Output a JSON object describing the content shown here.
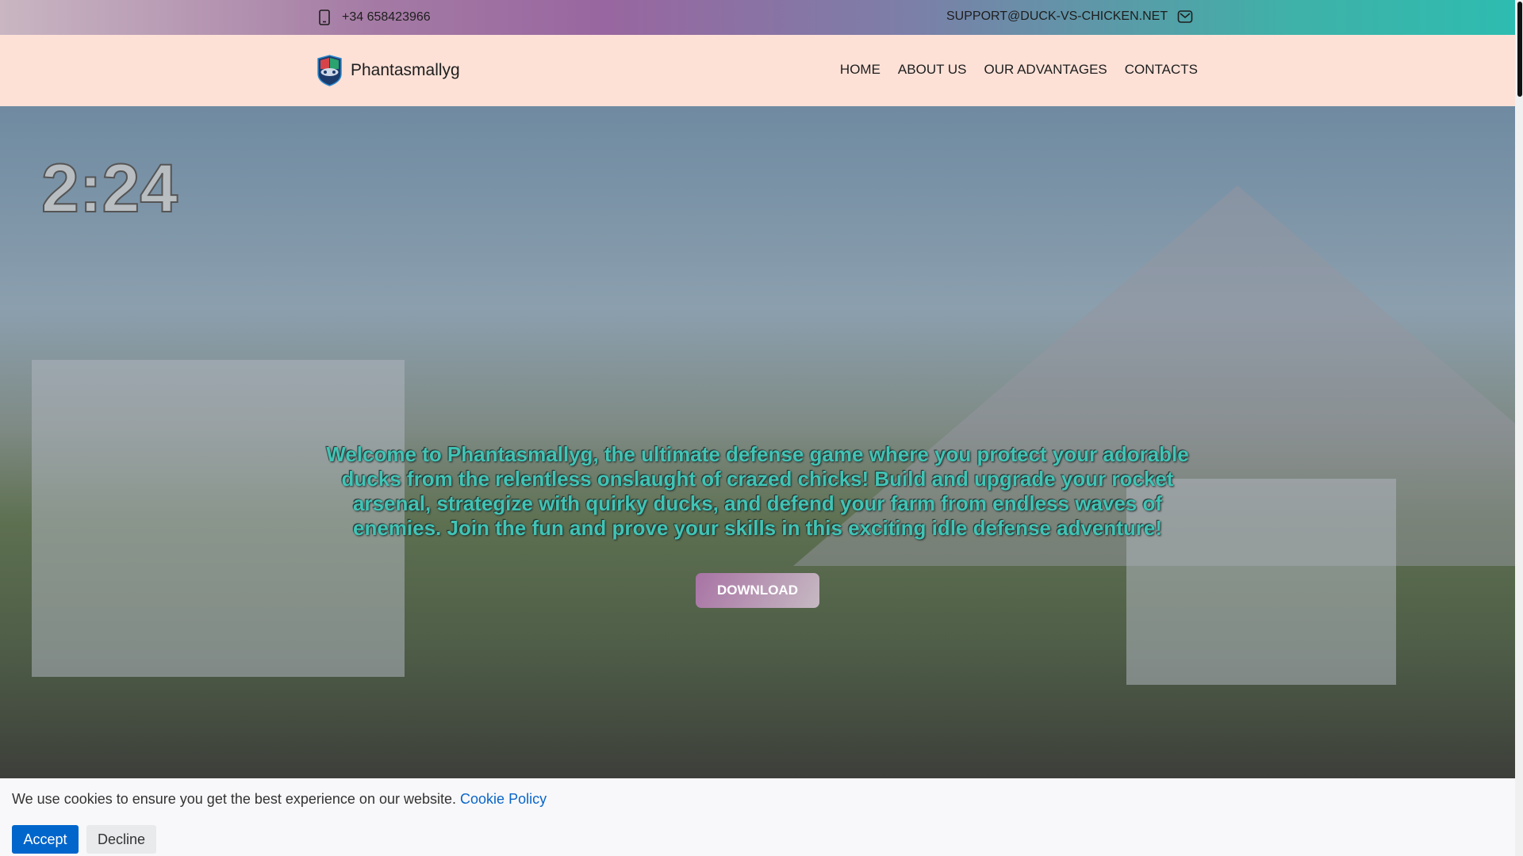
{
  "topbar": {
    "phone": "+34 658423966",
    "email": "SUPPORT@DUCK-VS-CHICKEN.NET"
  },
  "header": {
    "brand": "Phantasmallyg",
    "nav": [
      "HOME",
      "ABOUT US",
      "OUR ADVANTAGES",
      "CONTACTS"
    ]
  },
  "hero": {
    "timer": "2:24",
    "text": "Welcome to Phantasmallyg, the ultimate defense game where you protect your adorable ducks from the relentless onslaught of crazed chicks! Build and upgrade your rocket arsenal, strategize with quirky ducks, and defend your farm from endless waves of enemies. Join the fun and prove your skills in this exciting idle defense adventure!",
    "download": "DOWNLOAD"
  },
  "cookie": {
    "message": "We use cookies to ensure you get the best experience on our website.",
    "policy": "Cookie Policy",
    "accept": "Accept",
    "decline": "Decline"
  }
}
